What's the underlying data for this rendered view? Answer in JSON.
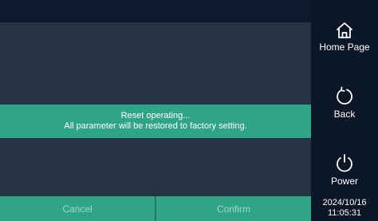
{
  "dialog": {
    "line1": "Reset operating...",
    "line2": "All parameter will be restored to factory setting.",
    "cancel_label": "Cancel",
    "confirm_label": "Confirm"
  },
  "sidebar": {
    "home_label": "Home Page",
    "back_label": "Back",
    "power_label": "Power",
    "date": "2024/10/16",
    "time": "11:05:31"
  },
  "colors": {
    "background": "#0b1626",
    "panel": "#243442",
    "accent": "#2fa486"
  },
  "icons": [
    "home-icon",
    "back-icon",
    "power-icon"
  ]
}
